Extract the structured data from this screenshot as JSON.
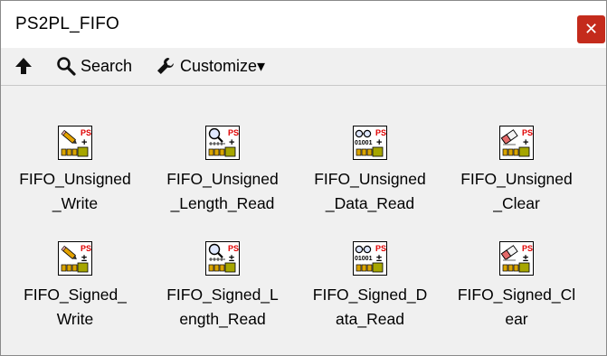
{
  "window": {
    "title": "PS2PL_FIFO",
    "close_symbol": "✕"
  },
  "toolbar": {
    "search_label": "Search",
    "customize_label": "Customize▾"
  },
  "palette": {
    "items": [
      {
        "label": "FIFO_Unsigned\n_Write",
        "icon": "write-pencil-icon",
        "sign": "+"
      },
      {
        "label": "FIFO_Unsigned\n_Length_Read",
        "icon": "length-read-magnifier-icon",
        "sign": "+"
      },
      {
        "label": "FIFO_Unsigned\n_Data_Read",
        "icon": "data-read-glasses-icon",
        "sign": "+"
      },
      {
        "label": "FIFO_Unsigned\n_Clear",
        "icon": "clear-eraser-icon",
        "sign": "+"
      },
      {
        "label": "FIFO_Signed_\nWrite",
        "icon": "write-pencil-icon",
        "sign": "±"
      },
      {
        "label": "FIFO_Signed_L\nength_Read",
        "icon": "length-read-magnifier-icon",
        "sign": "±"
      },
      {
        "label": "FIFO_Signed_D\nata_Read",
        "icon": "data-read-glasses-icon",
        "sign": "±"
      },
      {
        "label": "FIFO_Signed_Cl\near",
        "icon": "clear-eraser-icon",
        "sign": "±"
      }
    ]
  },
  "icon_text": {
    "ps": "PS",
    "bits": "01001"
  },
  "colors": {
    "close_bg": "#c42b1c",
    "ps_red": "#e00000",
    "fifo_gold": "#d9a400",
    "chip_olive": "#a6a600"
  }
}
